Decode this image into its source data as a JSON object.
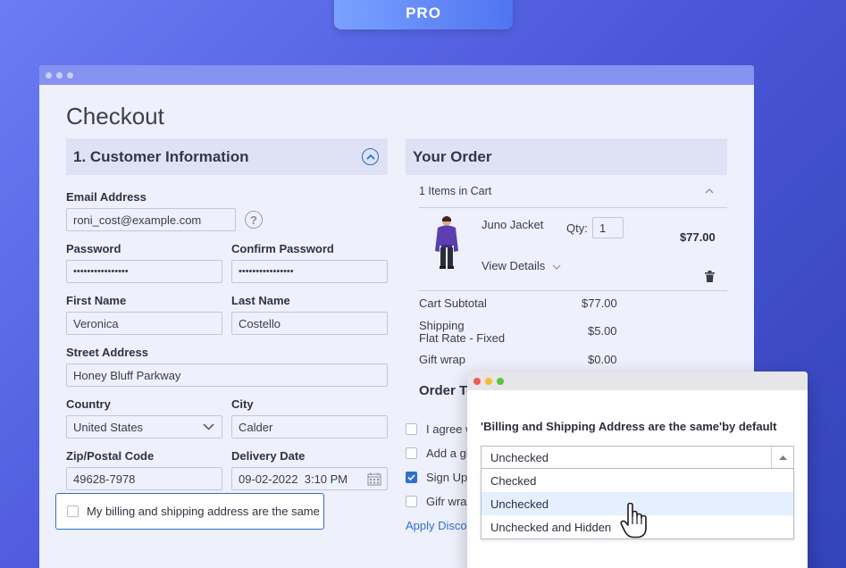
{
  "badge": "PRO",
  "page_title": "Checkout",
  "customer": {
    "heading": "1. Customer Information",
    "email_label": "Email Address",
    "email_value": "roni_cost@example.com",
    "help_glyph": "?",
    "password_label": "Password",
    "password_value": "••••••••••••••••",
    "confirm_label": "Confirm Password",
    "confirm_value": "••••••••••••••••",
    "first_label": "First Name",
    "first_value": "Veronica",
    "last_label": "Last Name",
    "last_value": "Costello",
    "street_label": "Street Address",
    "street_value": "Honey Bluff Parkway",
    "country_label": "Country",
    "country_value": "United States",
    "city_label": "City",
    "city_value": "Calder",
    "zip_label": "Zip/Postal Code",
    "zip_value": "49628-7978",
    "delivery_label": "Delivery Date",
    "delivery_value": "09-02-2022  3:10 PM",
    "billing_same_label": "My billing and shipping address are the same"
  },
  "order": {
    "heading": "Your Order",
    "items_in_cart": "1 Items in Cart",
    "product_name": "Juno Jacket",
    "qty_label": "Qty:",
    "qty_value": "1",
    "product_price": "$77.00",
    "view_details": "View Details",
    "subtotal_label": "Cart Subtotal",
    "subtotal_value": "$77.00",
    "shipping_label": "Shipping",
    "shipping_method": "Flat Rate - Fixed",
    "shipping_value": "$5.00",
    "giftwrap_label": "Gift wrap",
    "giftwrap_value": "$0.00",
    "order_total_partial": "Order To",
    "check_rows": [
      "I agree w",
      "Add a gi",
      "Sign Up",
      "Gifr wra"
    ],
    "apply_discount_partial": "Apply Discou"
  },
  "popup": {
    "title": "'Billing and Shipping Address are the same'by default",
    "selected": "Unchecked",
    "options": [
      "Checked",
      "Unchecked",
      "Unchecked and Hidden"
    ]
  },
  "colors": {
    "accent": "#2f6fd0",
    "window_bar": "#8592ef",
    "highlight": "#e4efff"
  }
}
